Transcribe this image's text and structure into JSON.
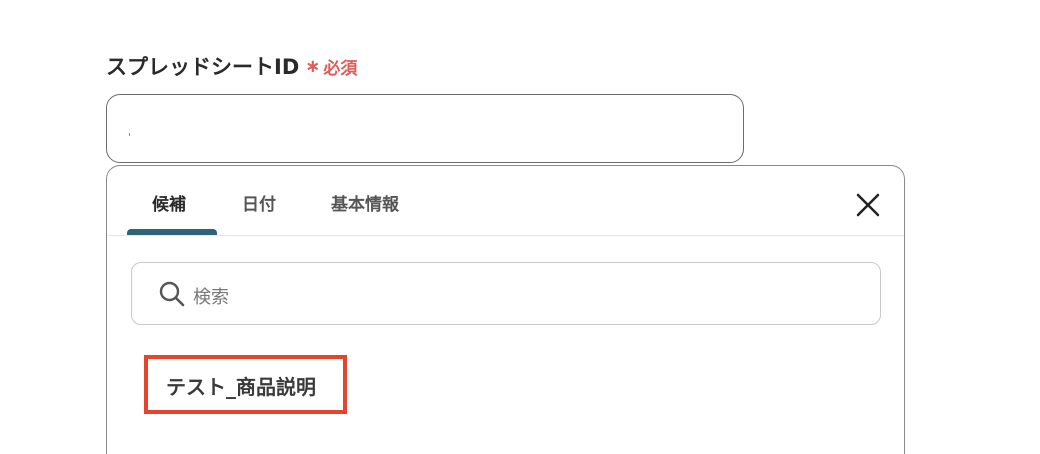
{
  "field": {
    "label": "スプレッドシートID",
    "required_star": "∗",
    "required_text": "必須",
    "value": ""
  },
  "dropdown": {
    "tabs": [
      {
        "label": "候補",
        "active": true
      },
      {
        "label": "日付",
        "active": false
      },
      {
        "label": "基本情報",
        "active": false
      }
    ],
    "search": {
      "placeholder": "検索",
      "icon": "search-icon"
    },
    "options": [
      {
        "label": "テスト_商品説明"
      }
    ],
    "close_icon": "close-icon"
  },
  "colors": {
    "required": "#e25b5b",
    "active_tab_underline": "#2f6378",
    "highlight_border": "#e6452d"
  }
}
